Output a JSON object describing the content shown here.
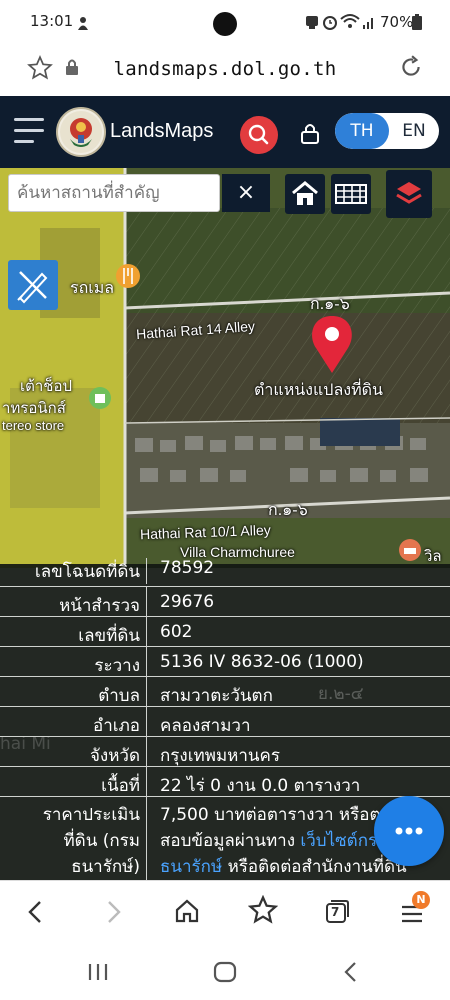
{
  "status_bar": {
    "time": "13:01",
    "battery": "70%"
  },
  "browser": {
    "url": "landsmaps.dol.go.th",
    "tab_count": "7",
    "menu_badge": "N"
  },
  "header": {
    "brand": "LandsMaps",
    "lang_th": "TH",
    "lang_en": "EN"
  },
  "map": {
    "search_placeholder": "ค้นหาสถานที่สำคัญ",
    "clear_symbol": "×",
    "labels": {
      "alley_top": "Hathai Rat 14 Alley",
      "alley_bottom": "Hathai Rat 10/1 Alley",
      "village": "Villa Charmchuree",
      "parcel_marker": "ตำแหน่งแปลงที่ดิน",
      "zone_top": "ก.๑-๖",
      "zone_bottom": "ก.๑-๖",
      "shop_top": "รถเมล",
      "shop_mid": "เต้าช็อป",
      "shop_mid2": "าทรอนิกส์",
      "shop_mid3": "tereo store",
      "village_right": "วิล",
      "faded_zone": "ย.๒-๔",
      "faded_text": "hai Mi"
    }
  },
  "parcel": {
    "rows": [
      {
        "label": "เลขโฉนดที่ดิน",
        "value": "78592"
      },
      {
        "label": "หน้าสำรวจ",
        "value": "29676"
      },
      {
        "label": "เลขที่ดิน",
        "value": "602"
      },
      {
        "label": "ระวาง",
        "value": "5136 IV 8632-06 (1000)"
      },
      {
        "label": "ตำบล",
        "value": "สามวาตะวันตก"
      },
      {
        "label": "อำเภอ",
        "value": "คลองสามวา"
      },
      {
        "label": "จังหวัด",
        "value": "กรุงเทพมหานคร"
      },
      {
        "label": "เนื้อที่",
        "value": "22 ไร่ 0 งาน 0.0 ตารางวา"
      }
    ],
    "price": {
      "label_line1": "ราคาประเมิน",
      "label_line2": "ที่ดิน (กรม",
      "label_line3": "ธนารักษ์)",
      "line1": "7,500 บาทต่อตารางวา หรือตร",
      "line2_text": "สอบข้อมูลผ่านทาง ",
      "line2_link": "เว็บไซต์กร",
      "line3_link": "ธนารักษ์",
      "line3_text": " หรือติดต่อสำนักงานที่ดิน"
    }
  },
  "fab": {
    "icon": "more-dots-icon"
  },
  "colors": {
    "header_bg": "#0e1c2e",
    "accent_blue": "#2f80d8",
    "search_red": "#e23c3f",
    "fab_blue": "#1f7fe6",
    "marker_red": "#e3263a"
  }
}
